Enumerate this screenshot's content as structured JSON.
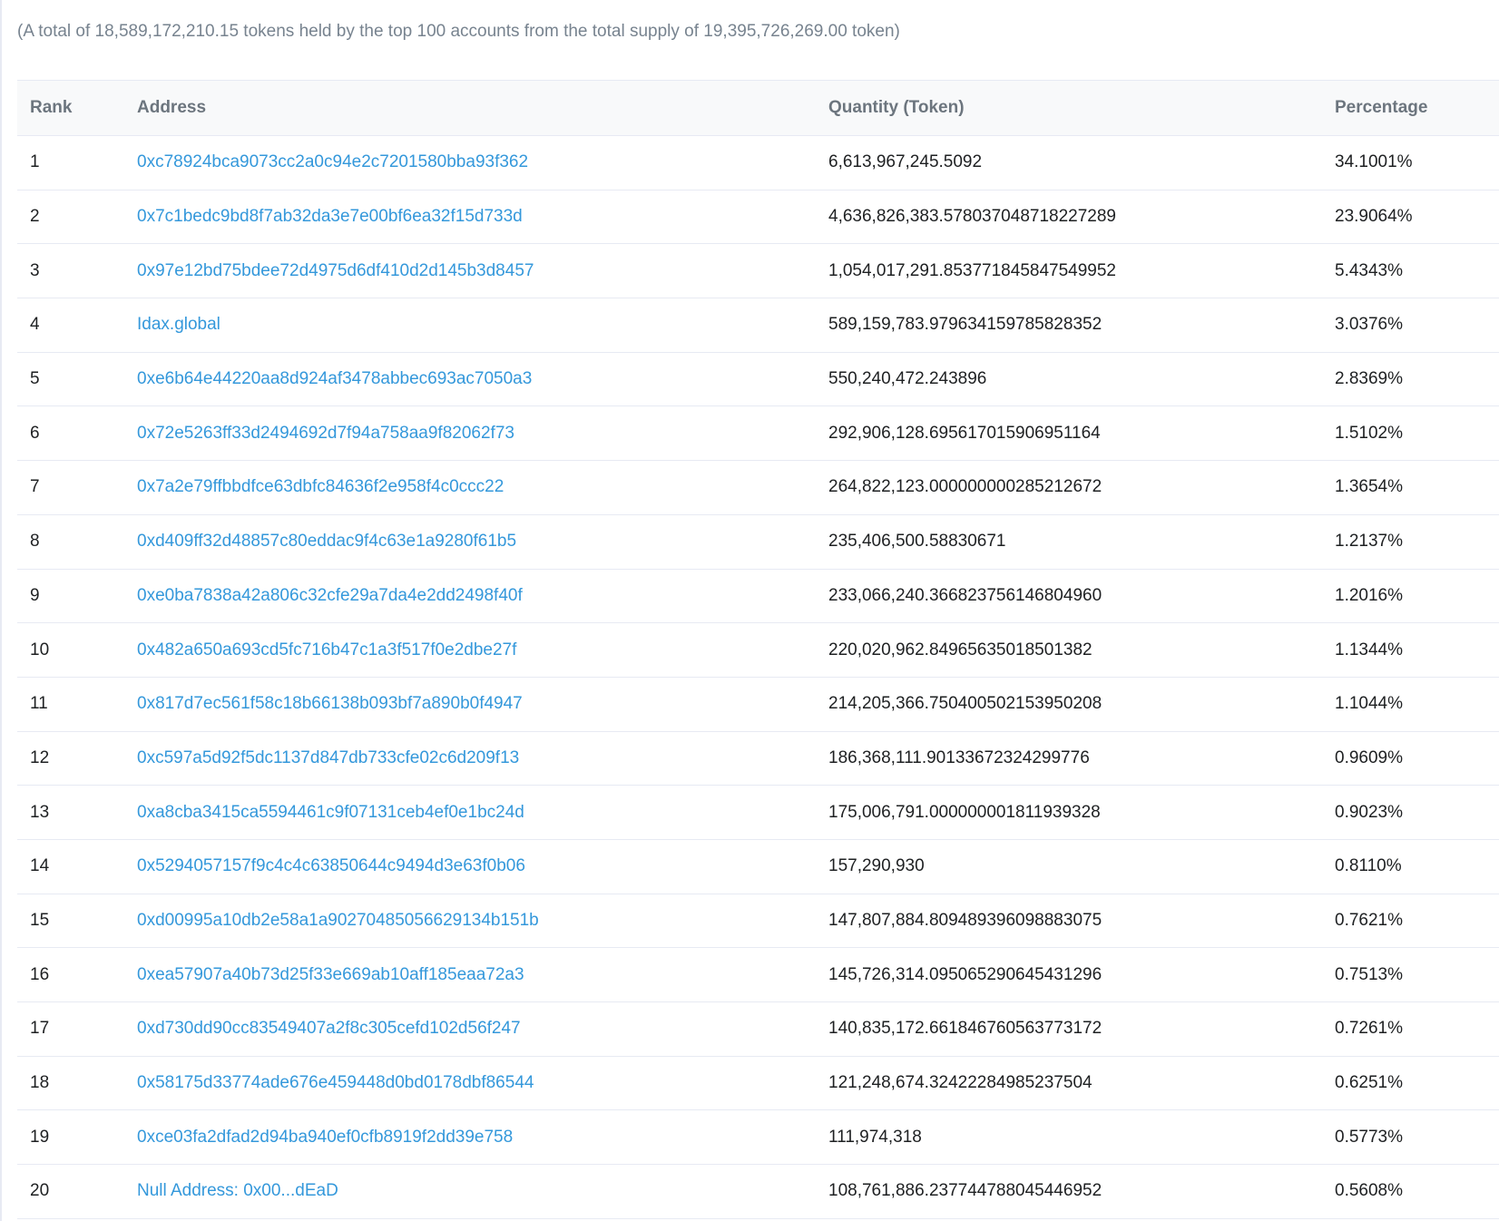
{
  "summary": "(A total of 18,589,172,210.15 tokens held by the top 100 accounts from the total supply of 19,395,726,269.00 token)",
  "table": {
    "headers": {
      "rank": "Rank",
      "address": "Address",
      "quantity": "Quantity (Token)",
      "percentage": "Percentage"
    },
    "rows": [
      {
        "rank": "1",
        "address": "0xc78924bca9073cc2a0c94e2c7201580bba93f362",
        "quantity": "6,613,967,245.5092",
        "percentage": "34.1001%"
      },
      {
        "rank": "2",
        "address": "0x7c1bedc9bd8f7ab32da3e7e00bf6ea32f15d733d",
        "quantity": "4,636,826,383.578037048718227289",
        "percentage": "23.9064%"
      },
      {
        "rank": "3",
        "address": "0x97e12bd75bdee72d4975d6df410d2d145b3d8457",
        "quantity": "1,054,017,291.853771845847549952",
        "percentage": "5.4343%"
      },
      {
        "rank": "4",
        "address": "Idax.global",
        "quantity": "589,159,783.979634159785828352",
        "percentage": "3.0376%"
      },
      {
        "rank": "5",
        "address": "0xe6b64e44220aa8d924af3478abbec693ac7050a3",
        "quantity": "550,240,472.243896",
        "percentage": "2.8369%"
      },
      {
        "rank": "6",
        "address": "0x72e5263ff33d2494692d7f94a758aa9f82062f73",
        "quantity": "292,906,128.695617015906951164",
        "percentage": "1.5102%"
      },
      {
        "rank": "7",
        "address": "0x7a2e79ffbbdfce63dbfc84636f2e958f4c0ccc22",
        "quantity": "264,822,123.000000000285212672",
        "percentage": "1.3654%"
      },
      {
        "rank": "8",
        "address": "0xd409ff32d48857c80eddac9f4c63e1a9280f61b5",
        "quantity": "235,406,500.58830671",
        "percentage": "1.2137%"
      },
      {
        "rank": "9",
        "address": "0xe0ba7838a42a806c32cfe29a7da4e2dd2498f40f",
        "quantity": "233,066,240.366823756146804960",
        "percentage": "1.2016%"
      },
      {
        "rank": "10",
        "address": "0x482a650a693cd5fc716b47c1a3f517f0e2dbe27f",
        "quantity": "220,020,962.84965635018501382",
        "percentage": "1.1344%"
      },
      {
        "rank": "11",
        "address": "0x817d7ec561f58c18b66138b093bf7a890b0f4947",
        "quantity": "214,205,366.750400502153950208",
        "percentage": "1.1044%"
      },
      {
        "rank": "12",
        "address": "0xc597a5d92f5dc1137d847db733cfe02c6d209f13",
        "quantity": "186,368,111.90133672324299776",
        "percentage": "0.9609%"
      },
      {
        "rank": "13",
        "address": "0xa8cba3415ca5594461c9f07131ceb4ef0e1bc24d",
        "quantity": "175,006,791.000000001811939328",
        "percentage": "0.9023%"
      },
      {
        "rank": "14",
        "address": "0x5294057157f9c4c4c63850644c9494d3e63f0b06",
        "quantity": "157,290,930",
        "percentage": "0.8110%"
      },
      {
        "rank": "15",
        "address": "0xd00995a10db2e58a1a90270485056629134b151b",
        "quantity": "147,807,884.809489396098883075",
        "percentage": "0.7621%"
      },
      {
        "rank": "16",
        "address": "0xea57907a40b73d25f33e669ab10aff185eaa72a3",
        "quantity": "145,726,314.095065290645431296",
        "percentage": "0.7513%"
      },
      {
        "rank": "17",
        "address": "0xd730dd90cc83549407a2f8c305cefd102d56f247",
        "quantity": "140,835,172.661846760563773172",
        "percentage": "0.7261%"
      },
      {
        "rank": "18",
        "address": "0x58175d33774ade676e459448d0bd0178dbf86544",
        "quantity": "121,248,674.32422284985237504",
        "percentage": "0.6251%"
      },
      {
        "rank": "19",
        "address": "0xce03fa2dfad2d94ba940ef0cfb8919f2dd39e758",
        "quantity": "111,974,318",
        "percentage": "0.5773%"
      },
      {
        "rank": "20",
        "address": "Null Address: 0x00...dEaD",
        "quantity": "108,761,886.237744788045446952",
        "percentage": "0.5608%"
      }
    ]
  },
  "colors": {
    "link": "#3498db",
    "text": "#1e2022",
    "muted": "#77838f",
    "header_bg": "#f8f9fa",
    "border": "#e7eaf3"
  }
}
